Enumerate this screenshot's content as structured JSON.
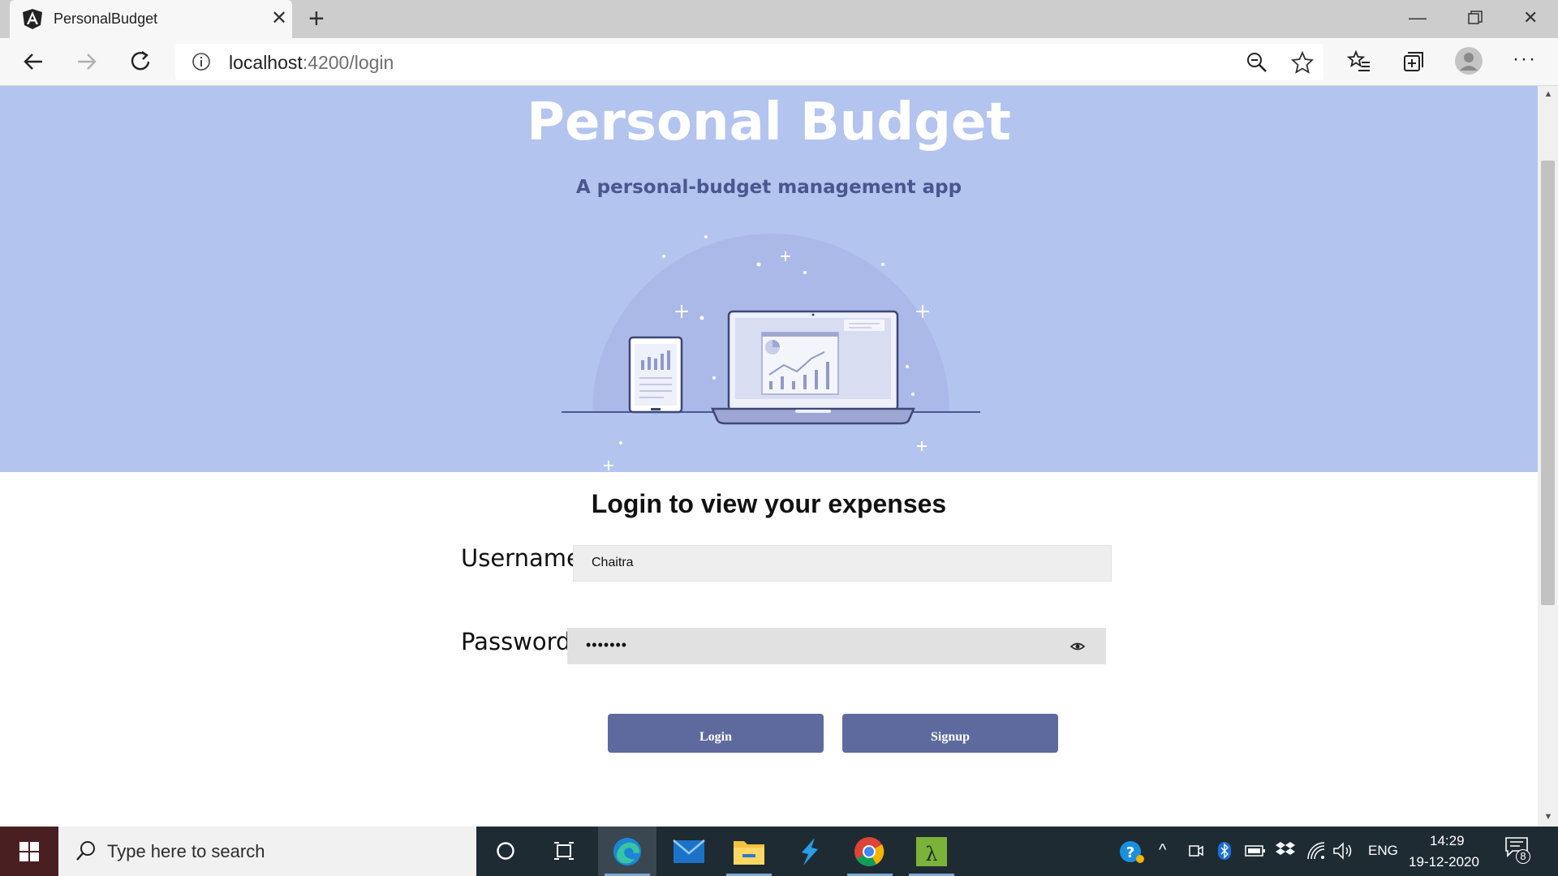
{
  "browser": {
    "tab_title": "PersonalBudget",
    "url_host": "localhost",
    "url_rest": ":4200/login"
  },
  "page": {
    "title": "Personal Budget",
    "subtitle": "A personal-budget management app",
    "login_heading": "Login to view your expenses",
    "username_label": "Username:",
    "username_value": "Chaitra",
    "password_label": "Password:",
    "password_value": "•••••••",
    "login_button": "Login",
    "signup_button": "Signup"
  },
  "taskbar": {
    "search_placeholder": "Type here to search",
    "language": "ENG",
    "time": "14:29",
    "date": "19-12-2020",
    "notification_count": "8"
  },
  "colors": {
    "hero_bg": "#b3c4ee",
    "subtitle": "#4a568f",
    "button": "#5e6a9e"
  },
  "icons": [
    "angular-icon",
    "close-icon",
    "plus-icon",
    "back-icon",
    "forward-icon",
    "refresh-icon",
    "info-icon",
    "zoom-icon",
    "star-icon",
    "favorites-icon",
    "collections-icon",
    "profile-icon",
    "more-icon",
    "eye-icon",
    "windows-icon",
    "search-icon",
    "cortana-icon",
    "taskview-icon",
    "edge-icon",
    "mail-icon",
    "explorer-icon",
    "vscode-icon",
    "chrome-icon",
    "app-icon",
    "help-icon",
    "bluetooth-icon",
    "battery-icon",
    "dropbox-icon",
    "wifi-icon",
    "volume-icon",
    "notification-icon"
  ]
}
